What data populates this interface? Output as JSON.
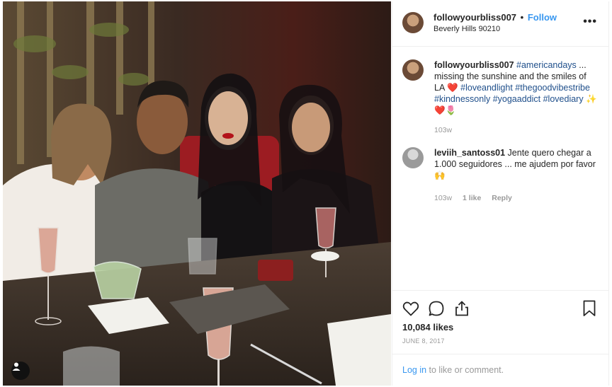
{
  "post": {
    "author": "followyourbliss007",
    "separator": "•",
    "follow_label": "Follow",
    "location": "Beverly Hills 90210",
    "more_label": "•••"
  },
  "comments": [
    {
      "username": "followyourbliss007",
      "parts": [
        {
          "text": " ",
          "type": "text"
        },
        {
          "text": "#americandays",
          "type": "tag"
        },
        {
          "text": " ... missing the sunshine and the smiles of LA ",
          "type": "text"
        },
        {
          "text": "❤️",
          "type": "emoji"
        },
        {
          "text": " ",
          "type": "text"
        },
        {
          "text": "#loveandlight",
          "type": "tag"
        },
        {
          "text": " ",
          "type": "text"
        },
        {
          "text": "#thegoodvibestribe",
          "type": "tag"
        },
        {
          "text": " ",
          "type": "text"
        },
        {
          "text": "#kindnessonly",
          "type": "tag"
        },
        {
          "text": " ",
          "type": "text"
        },
        {
          "text": "#yogaaddict",
          "type": "tag"
        },
        {
          "text": " ",
          "type": "text"
        },
        {
          "text": "#lovediary",
          "type": "tag"
        },
        {
          "text": " ✨❤️🌷",
          "type": "emoji"
        }
      ],
      "age": "103w"
    },
    {
      "username": "leviih_santoss01",
      "text": " Jente quero chegar a 1.000 seguidores ... me ajudem por favor 🙌",
      "age": "103w",
      "likes": "1 like",
      "reply": "Reply"
    }
  ],
  "actions": {
    "like_icon": "heart-icon",
    "comment_icon": "comment-bubble-icon",
    "share_icon": "share-icon",
    "save_icon": "bookmark-icon"
  },
  "likes": "10,084 likes",
  "date": "JUNE 8, 2017",
  "login": {
    "link": "Log in",
    "rest": " to like or comment."
  },
  "colors": {
    "link_blue": "#3897f0",
    "hashtag": "#1f4f8b",
    "muted": "#999999",
    "text": "#262626"
  }
}
